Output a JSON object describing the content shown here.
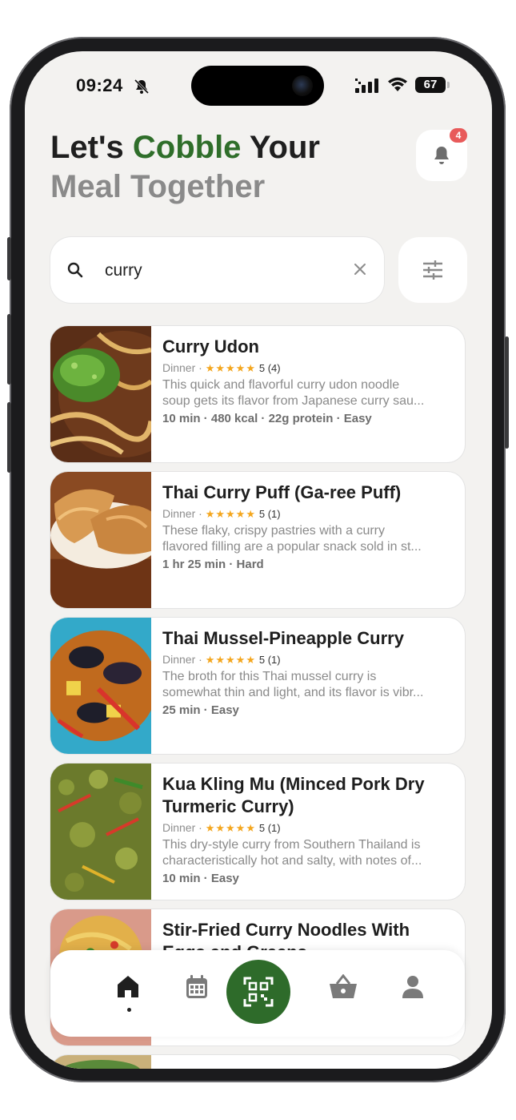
{
  "status_bar": {
    "time": "09:24",
    "battery": "67"
  },
  "header": {
    "line1_part1": "Let's ",
    "line1_brand": "Cobble",
    "line1_part2": " Your",
    "line2": "Meal Together",
    "notification_count": "4"
  },
  "search": {
    "value": "curry"
  },
  "recipes": [
    {
      "title": "Curry Udon",
      "category": "Dinner",
      "stars": "★★★★★",
      "rating": "5 (4)",
      "desc1": "This quick and flavorful curry udon noodle",
      "desc2": "soup gets its flavor from Japanese curry sau...",
      "stats": "10 min  ·  480 kcal  ·  22g protein  ·  Easy"
    },
    {
      "title": "Thai Curry Puff (Ga-ree Puff)",
      "category": "Dinner",
      "stars": "★★★★★",
      "rating": "5 (1)",
      "desc1": "These flaky, crispy pastries with a curry",
      "desc2": "flavored filling are a popular snack sold in st...",
      "stats": "1 hr 25 min  ·  Hard"
    },
    {
      "title": "Thai Mussel-Pineapple Curry",
      "category": "Dinner",
      "stars": "★★★★★",
      "rating": "5 (1)",
      "desc1": "The broth for this Thai mussel curry is",
      "desc2": "somewhat thin and light, and its flavor is vibr...",
      "stats": "25 min  ·  Easy"
    },
    {
      "title": "Kua Kling Mu (Minced Pork Dry Turmeric Curry)",
      "category": "Dinner",
      "stars": "★★★★★",
      "rating": "5 (1)",
      "desc1": "This dry-style curry from Southern Thailand is",
      "desc2": "characteristically hot and salty, with notes of...",
      "stats": "10 min  ·  Easy"
    },
    {
      "title": "Stir-Fried Curry Noodles With Eggs and Greens"
    }
  ],
  "nav": {
    "items": [
      "home-icon",
      "calendar-icon",
      "qr-scan-icon",
      "basket-icon",
      "profile-icon"
    ],
    "active": "home"
  },
  "colors": {
    "brand_green": "#2f6e2a",
    "badge_red": "#e85a5a",
    "star": "#f4a61d",
    "background": "#f3f2f0"
  }
}
